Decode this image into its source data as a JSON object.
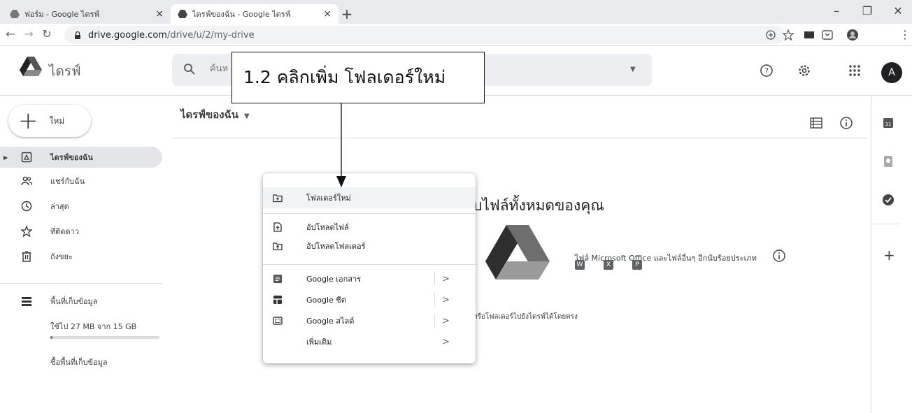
{
  "browser": {
    "tabs": [
      {
        "title": "ฟอร์ม - Google ไดรฟ์",
        "active": false
      },
      {
        "title": "ไดรฟ์ของฉัน - Google ไดรฟ์",
        "active": true
      }
    ],
    "url_host": "drive.google.com",
    "url_path": "/drive/u/2/my-drive"
  },
  "app": {
    "title": "ไดรฟ์",
    "search_placeholder": "ค้นห",
    "avatar_letter": "A"
  },
  "sidebar": {
    "new_label": "ใหม่",
    "items": [
      {
        "label": "ไดรฟ์ของฉัน",
        "icon": "my-drive-icon",
        "selected": true
      },
      {
        "label": "แชร์กับฉัน",
        "icon": "shared-people-icon"
      },
      {
        "label": "ล่าสุด",
        "icon": "clock-icon"
      },
      {
        "label": "ที่ติดดาว",
        "icon": "star-icon"
      },
      {
        "label": "ถังขยะ",
        "icon": "trash-icon"
      }
    ],
    "storage": {
      "label": "พื้นที่เก็บข้อมูล",
      "used_text": "ใช้ไป 27 MB จาก 15 GB",
      "used_fraction": 0.0018,
      "buy_label": "ซื้อพื้นที่เก็บข้อมูล"
    }
  },
  "main": {
    "breadcrumb": "ไดรฟ์ของฉัน",
    "empty_title": "บไฟล์ทั้งหมดของคุณ",
    "filetypes_text": "ไฟล์ Microsoft Office และไฟล์อื่นๆ อีกนับร้อยประเภท",
    "filetype_chips": [
      "W",
      "X",
      "P"
    ],
    "drop_hint": "หรือโฟลเดอร์ไปยังไดรฟ์ได้โดยตรง"
  },
  "menu": {
    "items": [
      {
        "label": "โฟลเดอร์ใหม่",
        "icon": "new-folder-icon"
      },
      {
        "label": "อัปโหลดไฟล์",
        "icon": "file-upload-icon"
      },
      {
        "label": "อัปโหลดโฟลเดอร์",
        "icon": "folder-upload-icon"
      },
      {
        "label": "Google เอกสาร",
        "icon": "google-docs-icon",
        "submenu": true
      },
      {
        "label": "Google ชีต",
        "icon": "google-sheets-icon",
        "submenu": true
      },
      {
        "label": "Google สไลด์",
        "icon": "google-slides-icon",
        "submenu": true
      },
      {
        "label": "เพิ่มเติม",
        "icon": "",
        "submenu": true
      }
    ],
    "submenu_arrow": ">"
  },
  "annotation": {
    "text": "1.2 คลิกเพิ่ม โฟลเดอร์ใหม่"
  },
  "colors": {
    "drive_green": "#1e8e3e",
    "drive_yellow": "#fbbc04",
    "drive_blue": "#4285f4",
    "sidebar_selected": "#e3e5e8"
  }
}
